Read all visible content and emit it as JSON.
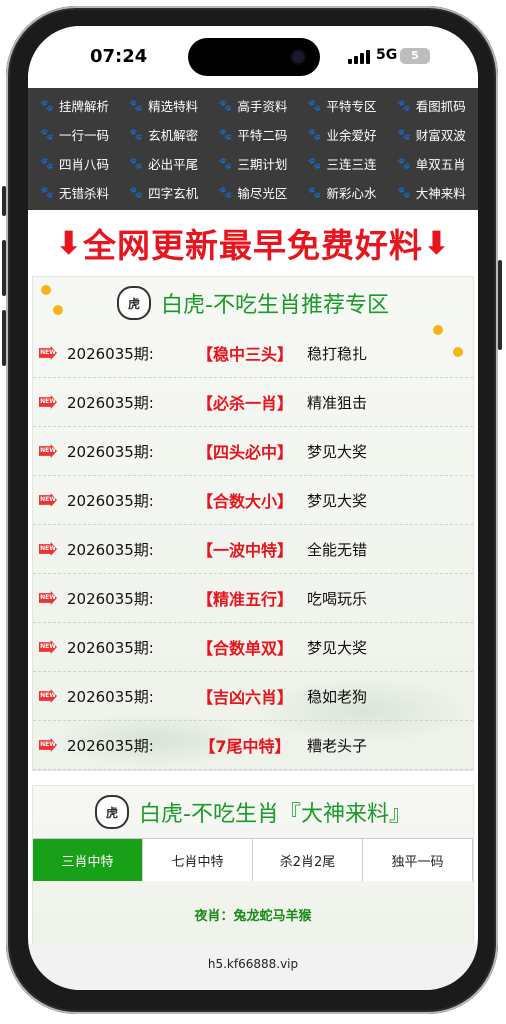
{
  "status_bar": {
    "time": "07:24",
    "network": "5G",
    "battery": "5"
  },
  "menu": [
    "挂牌解析",
    "精选特料",
    "高手资料",
    "平特专区",
    "看图抓码",
    "一行一码",
    "玄机解密",
    "平特二码",
    "业余爱好",
    "财富双波",
    "四肖八码",
    "必出平尾",
    "三期计划",
    "三连三连",
    "单双五肖",
    "无错杀料",
    "四字玄机",
    "输尽光区",
    "新彩心水",
    "大神来料"
  ],
  "banner": {
    "text": "全网更新最早免费好料",
    "arrow": "⬇"
  },
  "section1": {
    "title": "白虎-不吃生肖推荐专区",
    "rows": [
      {
        "period": "2026035期:",
        "pick": "【稳中三头】",
        "tag": "稳打稳扎"
      },
      {
        "period": "2026035期:",
        "pick": "【必杀一肖】",
        "tag": "精准狙击"
      },
      {
        "period": "2026035期:",
        "pick": "【四头必中】",
        "tag": "梦见大奖"
      },
      {
        "period": "2026035期:",
        "pick": "【合数大小】",
        "tag": "梦见大奖"
      },
      {
        "period": "2026035期:",
        "pick": "【一波中特】",
        "tag": "全能无错"
      },
      {
        "period": "2026035期:",
        "pick": "【精准五行】",
        "tag": "吃喝玩乐"
      },
      {
        "period": "2026035期:",
        "pick": "【合数单双】",
        "tag": "梦见大奖"
      },
      {
        "period": "2026035期:",
        "pick": "【吉凶六肖】",
        "tag": "稳如老狗"
      },
      {
        "period": "2026035期:",
        "pick": "【7尾中特】",
        "tag": "糟老头子"
      }
    ]
  },
  "section2": {
    "title": "白虎-不吃生肖『大神来料』",
    "tabs": [
      "三肖中特",
      "七肖中特",
      "杀2肖2尾",
      "独平一码"
    ],
    "active_tab": 0,
    "night_label": "夜肖：兔龙蛇马羊猴"
  },
  "url": "h5.kf66888.vip",
  "colors": {
    "accent_green": "#18a018",
    "highlight_red": "#e8141e",
    "menu_bg": "#3b3b3b"
  }
}
